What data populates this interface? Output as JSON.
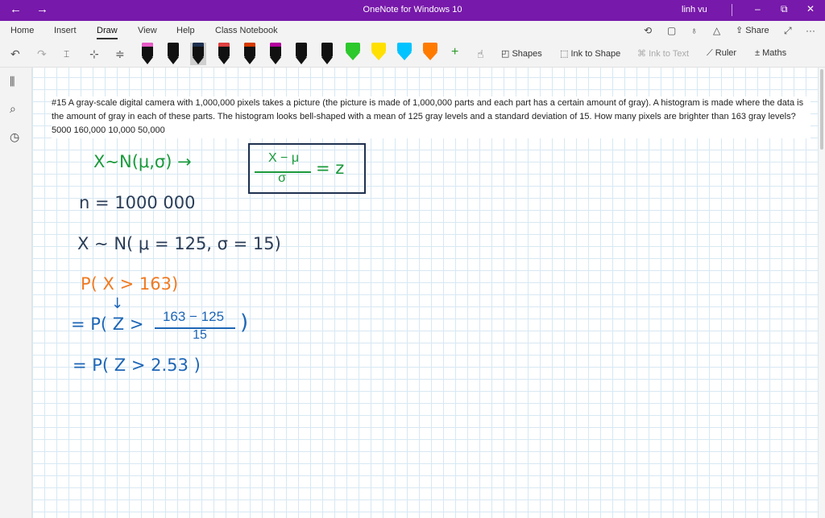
{
  "titlebar": {
    "back": "←",
    "forward": "→",
    "title": "OneNote for Windows 10",
    "user": "linh vu",
    "minimize": "–",
    "restore": "⧉",
    "close": "✕"
  },
  "tabs": {
    "home": "Home",
    "insert": "Insert",
    "draw": "Draw",
    "view": "View",
    "help": "Help",
    "class_notebook": "Class Notebook",
    "share": "Share",
    "more": "···"
  },
  "toolbar": {
    "shapes": "Shapes",
    "ink_to_shape": "Ink to Shape",
    "ink_to_text": "Ink to Text",
    "ruler": "Ruler",
    "maths": "Maths",
    "add_pen": "+",
    "pen_colors": [
      "#e85cc6",
      "#111111",
      "#1f3150",
      "#e04040",
      "#d83b01",
      "#b4009e",
      "#111111",
      "#111111",
      "#2cc82c",
      "#ffe000",
      "#00c3ff",
      "#ff7b00"
    ]
  },
  "problem": {
    "text": "#15 A gray-scale digital camera with 1,000,000 pixels takes a picture (the picture is made of 1,000,000 parts and each part has a certain amount of gray). A histogram is made where the data is the amount of gray in each of these parts. The histogram looks bell-shaped with a mean of 125 gray levels and a standard deviation of 15. How many pixels are brighter than 163 gray levels? 5000 160,000 10,000 50,000"
  },
  "ink": {
    "line1": "X∼N(μ,σ) →",
    "box_num": "X − μ",
    "box_den": "σ",
    "box_eq": "= z",
    "line2": "n = 1000 000",
    "line3": "X ∼ N( μ = 125, σ = 15)",
    "line4": "P( X > 163)",
    "arrow": "↓",
    "line5_pre": "= P( Z >",
    "line5_num": "163 − 125",
    "line5_den": "15",
    "line5_post": ")",
    "line6": "= P( Z > 2.53 )"
  }
}
